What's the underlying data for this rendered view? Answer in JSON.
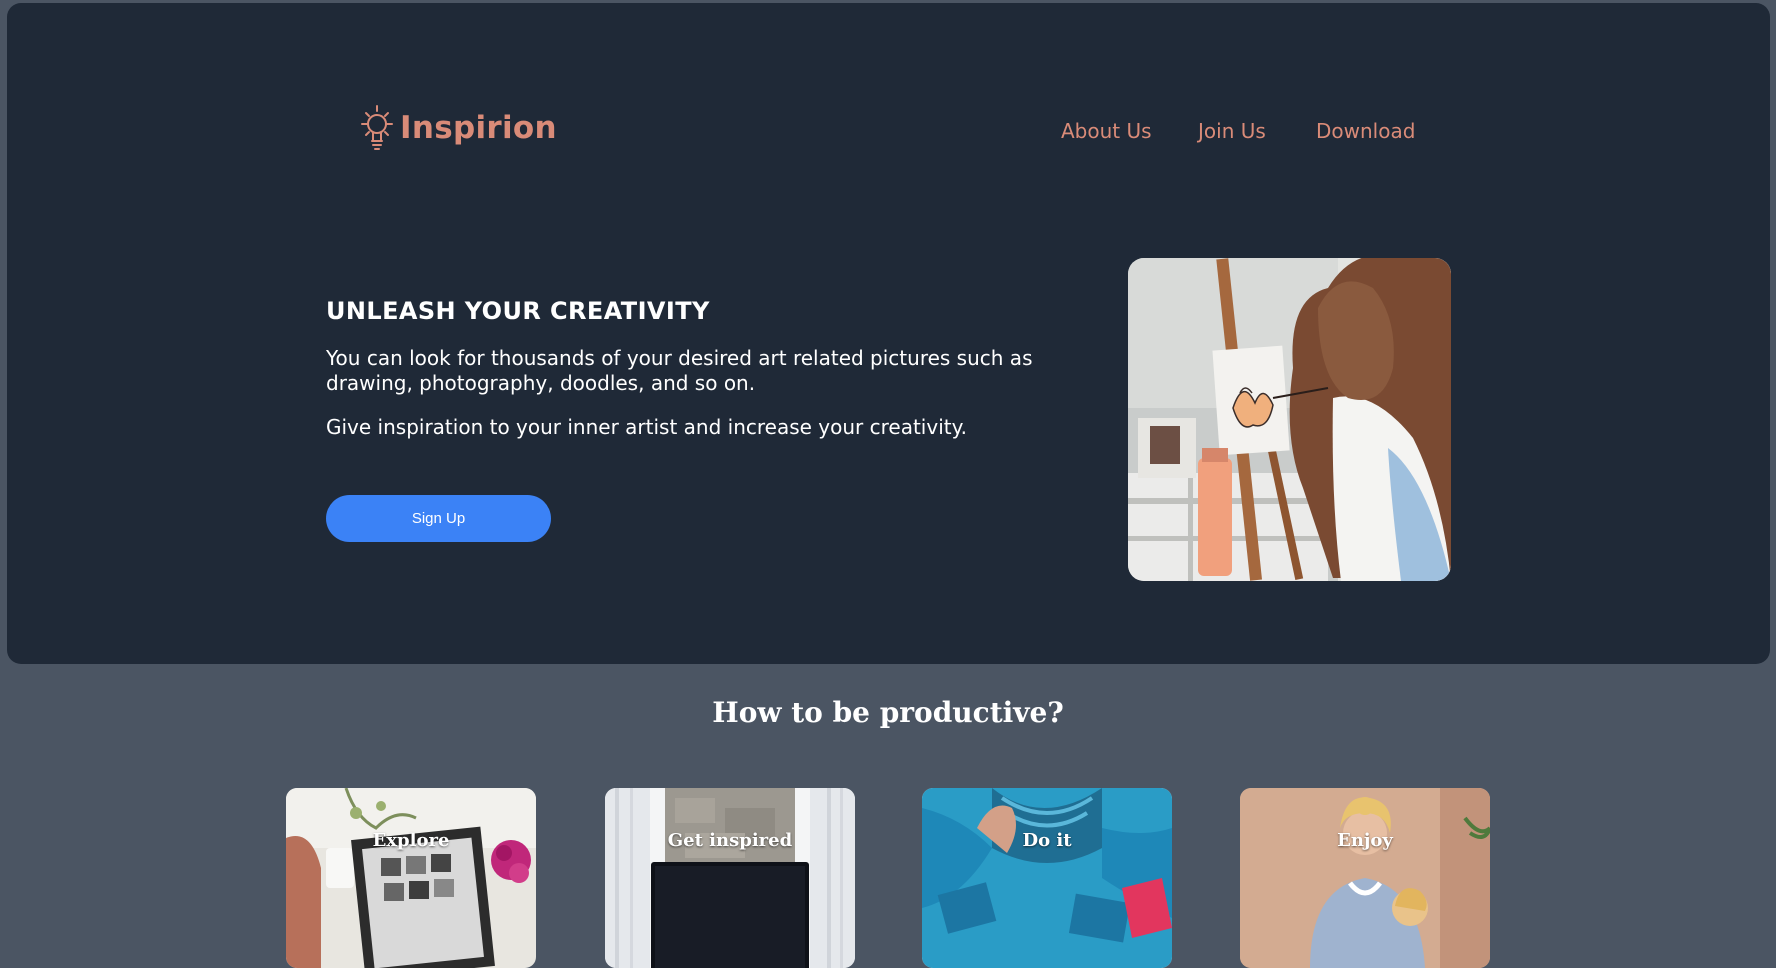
{
  "brand": {
    "name": "Inspirion",
    "icon": "lightbulb-icon",
    "color": "#d98b78"
  },
  "nav": {
    "items": [
      {
        "label": "About Us"
      },
      {
        "label": "Join Us"
      },
      {
        "label": "Download"
      }
    ]
  },
  "hero": {
    "title": "UNLEASH YOUR CREATIVITY",
    "description": "You can look for thousands of your desired art related pictures such as drawing, photography, doodles, and so on.",
    "description2": "Give inspiration to your inner artist and increase your creativity.",
    "cta_label": "Sign Up",
    "image": "woman-painting-at-easel-photo",
    "background": "#1f2937",
    "cta_color": "#3b82f6"
  },
  "section": {
    "title": "How to be productive?",
    "background": "#4b5563"
  },
  "cards": [
    {
      "label": "Explore",
      "image": "laptop-with-flowers-photo"
    },
    {
      "label": "Get inspired",
      "image": "fireplace-with-monitor-photo"
    },
    {
      "label": "Do it",
      "image": "knitted-blue-sweater-photo"
    },
    {
      "label": "Enjoy",
      "image": "mother-and-child-photo"
    }
  ]
}
